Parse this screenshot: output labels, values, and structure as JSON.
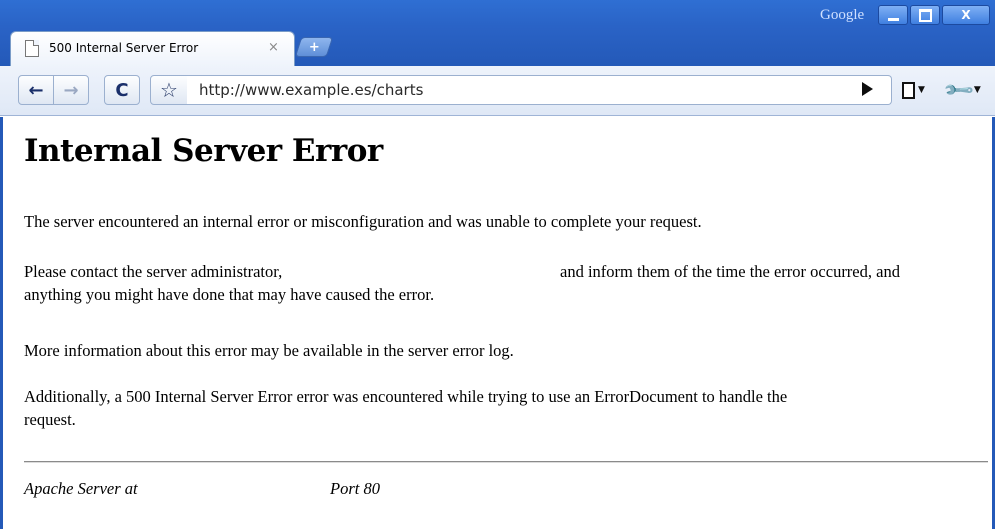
{
  "window": {
    "brand_label": "Google",
    "minimize_label": "",
    "close_label": "X"
  },
  "tab": {
    "title": "500 Internal Server Error",
    "close_label": "×",
    "new_tab_label": "+"
  },
  "toolbar": {
    "back_label": "←",
    "forward_label": "→",
    "reload_label": "C",
    "star_label": "☆",
    "url": "http://www.example.es/charts"
  },
  "page": {
    "heading": "Internal Server Error",
    "para1": "The server encountered an internal error or misconfiguration and was unable to complete your request.",
    "para2_part1": "Please contact the server administrator,",
    "para2_part2": "and inform them of the time the error occurred, and",
    "para2_line2": "anything you might have done that may have caused the error.",
    "para3": "More information about this error may be available in the server error log.",
    "para4_line1": "Additionally, a 500 Internal Server Error error was encountered while trying to use an ErrorDocument to handle the",
    "para4_line2": "request.",
    "address_part1": "Apache Server at",
    "address_part2": "Port 80"
  },
  "icons": {
    "tab": "document-icon",
    "go": "play-icon",
    "page_menu": "page-menu-icon",
    "tools_menu": "wrench-icon"
  },
  "colors": {
    "titlebar": "#2a63c6",
    "toolbar": "#e6edf8",
    "page_background": "#ffffff",
    "text": "#000000"
  }
}
